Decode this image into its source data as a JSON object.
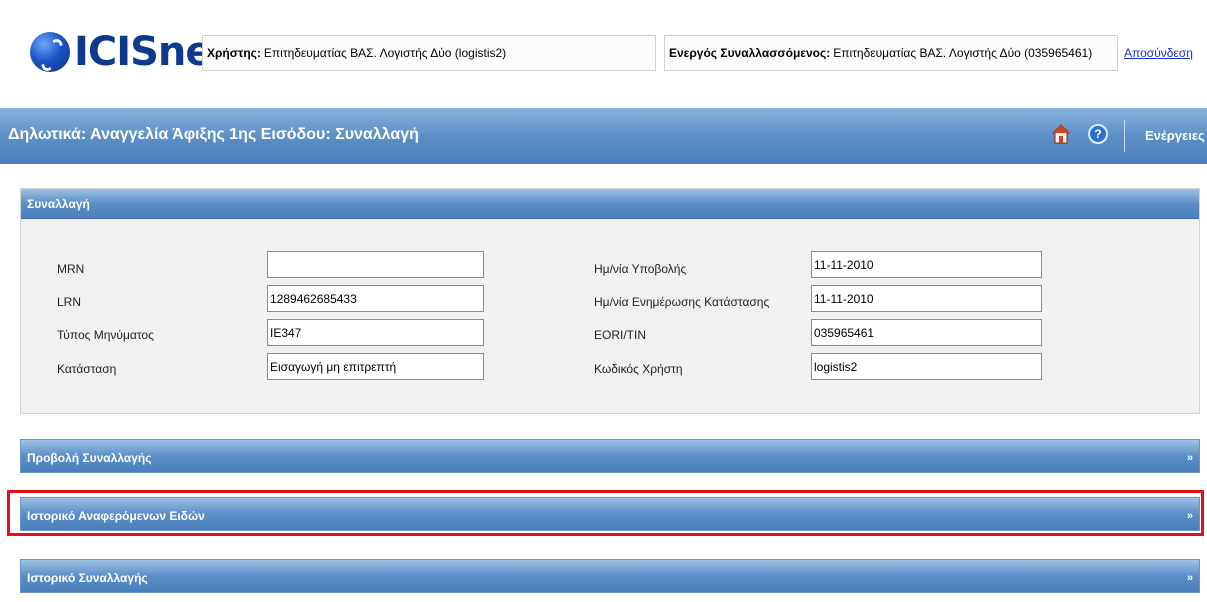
{
  "header": {
    "logo_text": "ICISnet",
    "user_label": "Χρήστης:",
    "user_value": "Επιτηδευματίας ΒΑΣ. Λογιστής Δύο (logistis2)",
    "trader_label": "Ενεργός Συναλλασσόμενος:",
    "trader_value": "Επιτηδευματίας ΒΑΣ. Λογιστής Δύο (035965461)",
    "logout_label": "Αποσύνδεση"
  },
  "title_bar": {
    "title": "Δηλωτικά: Αναγγελία Άφιξης 1ης Εισόδου: Συναλλαγή",
    "help_symbol": "?",
    "actions_label": "Ενέργειες",
    "icons": [
      "home-icon",
      "help-icon"
    ]
  },
  "section": {
    "title": "Συναλλαγή",
    "fields_left": [
      {
        "label": "MRN",
        "value": ""
      },
      {
        "label": "LRN",
        "value": "1289462685433"
      },
      {
        "label": "Τύπος Μηνύματος",
        "value": "IE347"
      },
      {
        "label": "Κατάσταση",
        "value": "Εισαγωγή μη επιτρεπτή"
      }
    ],
    "fields_right": [
      {
        "label": "Ημ/νία Υποβολής",
        "value": "11-11-2010"
      },
      {
        "label": "Ημ/νία Ενημέρωσης Κατάστασης",
        "value": "11-11-2010"
      },
      {
        "label": "EORI/TIN",
        "value": "035965461"
      },
      {
        "label": "Κωδικός Χρήστη",
        "value": "logistis2"
      }
    ]
  },
  "collapsibles": [
    {
      "title": "Προβολή Συναλλαγής",
      "arrow": "»"
    },
    {
      "title": "Ιστορικό Αναφερόμενων Ειδών",
      "arrow": "»"
    },
    {
      "title": "Ιστορικό Συναλλαγής",
      "arrow": "»"
    }
  ],
  "colors": {
    "bar_blue": "#5b8ec7",
    "highlight_red": "#e0111b",
    "link_blue": "#1a2fd0"
  }
}
